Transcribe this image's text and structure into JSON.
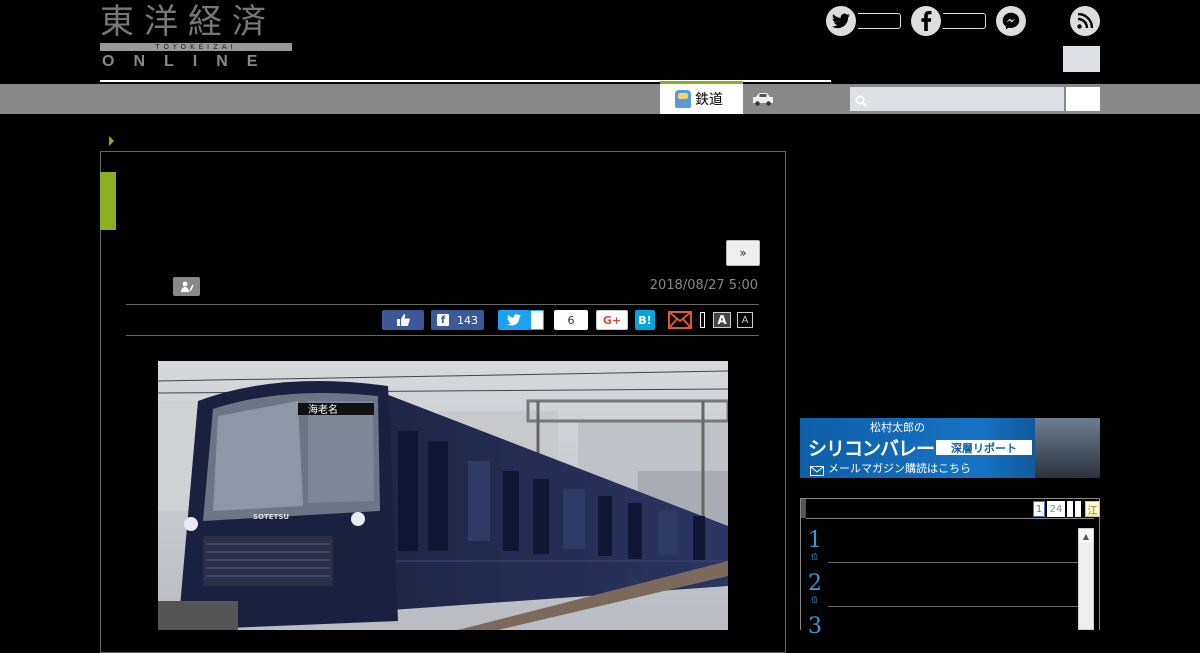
{
  "header": {
    "logo_title": "東洋経済",
    "logo_sub": "TOYOKEIZAI",
    "logo_online": "ONLINE"
  },
  "social": {
    "twitter_icon": "twitter-icon",
    "facebook_icon": "facebook-icon",
    "messenger_icon": "messenger-icon",
    "rss_icon": "rss-icon"
  },
  "nav": {
    "active_tab_label": "鉄道",
    "active_tab_icon": "train-icon",
    "second_tab_icon": "car-icon",
    "accent_color": "#8ab020",
    "search_placeholder": ""
  },
  "article": {
    "next_label": "»",
    "date": "2018/08/27 5:00",
    "share": {
      "facebook_count": "143",
      "hatena_count": "6",
      "google_label": "G+",
      "hatena_label": "B!",
      "font_large": "A",
      "font_small": "A"
    },
    "photo": {
      "destination_sign": "海老名",
      "brand_label": "SOTETSU"
    }
  },
  "sidebar": {
    "banner": {
      "top_text": "松村太郎の",
      "main_text": "シリコンバレー",
      "tag_text": "深層リポート",
      "cta_text": "メールマガジン購読はこちら"
    },
    "ranking": {
      "tabs": [
        "1",
        "24",
        "",
        "",
        "江"
      ],
      "numbers": [
        "1",
        "2",
        "3"
      ],
      "unit": "位"
    }
  }
}
